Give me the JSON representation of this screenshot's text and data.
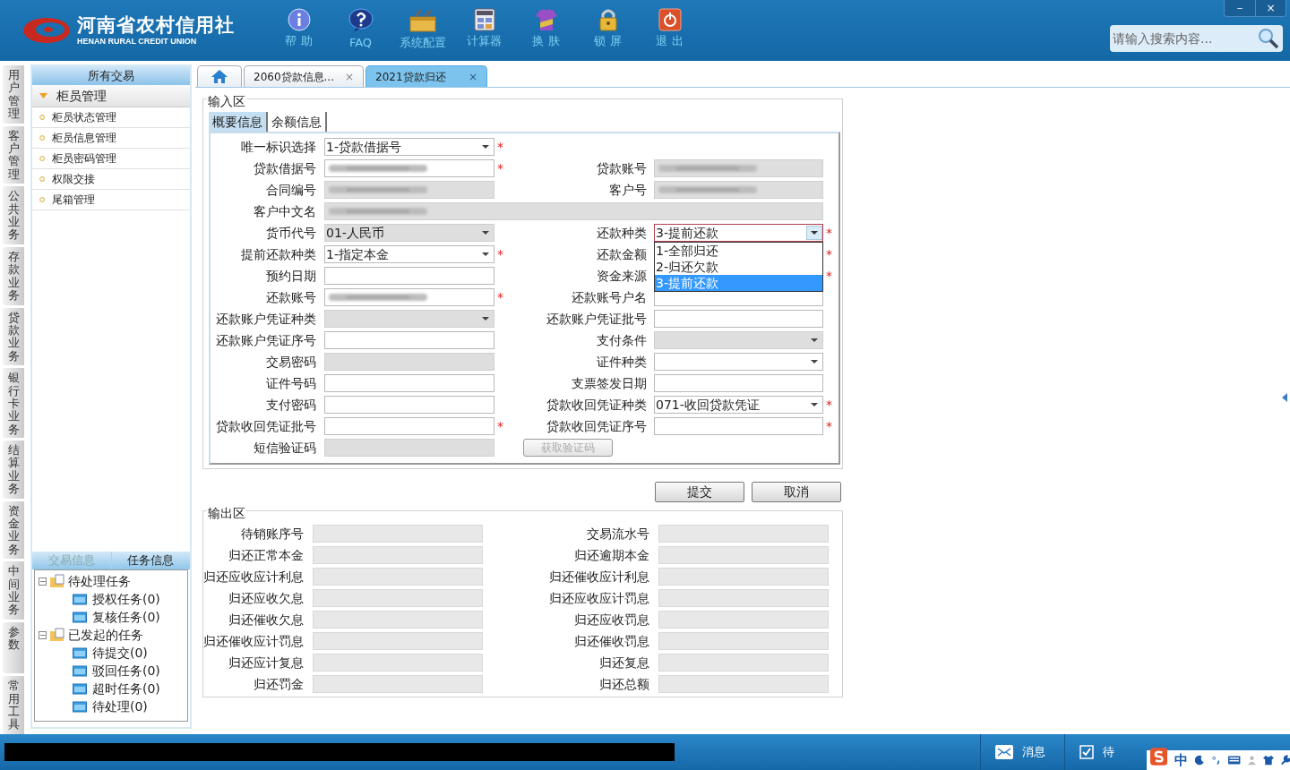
{
  "header": {
    "logo_cn": "河南省农村信用社",
    "logo_en": "HENAN RURAL CREDIT UNION",
    "tools": [
      {
        "label": "帮 助"
      },
      {
        "label": "FAQ"
      },
      {
        "label": "系统配置"
      },
      {
        "label": "计算器"
      },
      {
        "label": "换 肤"
      },
      {
        "label": "锁 屏"
      },
      {
        "label": "退 出"
      }
    ],
    "search": {
      "placeholder": "请输入搜索内容..."
    },
    "window_buttons": [
      "－",
      "×"
    ]
  },
  "side_tabs": [
    "用户管理",
    "客户管理",
    "公共业务",
    "存款业务",
    "贷款业务",
    "银行卡业务",
    "结算业务",
    "资金业务",
    "中间业务",
    "参数",
    "常用工具"
  ],
  "menu": {
    "title": "所有交易",
    "group": {
      "label": "柜员管理",
      "expanded": true,
      "items": [
        "柜员状态管理",
        "柜员信息管理",
        "柜员密码管理",
        "权限交接",
        "尾箱管理"
      ]
    }
  },
  "info_tabs": [
    {
      "label": "交易信息",
      "selected": false
    },
    {
      "label": "任务信息",
      "selected": true
    }
  ],
  "task_tree": [
    {
      "label": "待处理任务",
      "toggle": "−",
      "children": [
        {
          "label": "授权任务(0)"
        },
        {
          "label": "复核任务(0)"
        }
      ]
    },
    {
      "label": "已发起的任务",
      "toggle": "−",
      "children": [
        {
          "label": "待提交(0)"
        },
        {
          "label": "驳回任务(0)"
        },
        {
          "label": "超时任务(0)"
        },
        {
          "label": "待处理(0)"
        }
      ]
    }
  ],
  "doc_tabs": [
    {
      "kind": "home",
      "selected": false
    },
    {
      "kind": "text",
      "label": "2060贷款信息...",
      "close": "×",
      "selected": false
    },
    {
      "kind": "text",
      "label": "2021贷款归还",
      "close": "×",
      "selected": true
    }
  ],
  "input_area": {
    "title": "输入区",
    "tabs": [
      {
        "label": "概要信息",
        "selected": true
      },
      {
        "label": "余额信息",
        "selected": false
      }
    ],
    "rows": [
      {
        "left": {
          "label": "唯一标识选择",
          "kind": "select",
          "value": "1-贷款借据号",
          "mark": "*",
          "disabled": false
        }
      },
      {
        "left": {
          "label": "贷款借据号",
          "kind": "text",
          "redacted": true,
          "mark": "*",
          "disabled": false
        },
        "right": {
          "label": "贷款账号",
          "kind": "text",
          "redacted": true,
          "disabled": true
        }
      },
      {
        "left": {
          "label": "合同编号",
          "kind": "text",
          "redacted": true,
          "disabled": true
        },
        "right": {
          "label": "客户号",
          "kind": "text",
          "redacted": true,
          "disabled": true
        }
      },
      {
        "wide": true,
        "left": {
          "label": "客户中文名",
          "kind": "text",
          "redacted": true,
          "disabled": true
        }
      },
      {
        "left": {
          "label": "货币代号",
          "kind": "select",
          "value": "01-人民币",
          "disabled": true
        },
        "right": {
          "label": "还款种类",
          "kind": "select",
          "value": "3-提前还款",
          "mark": "*",
          "disabled": false,
          "open": true,
          "options": [
            {
              "label": "1-全部归还",
              "selected": false
            },
            {
              "label": "2-归还欠款",
              "selected": false
            },
            {
              "label": "3-提前还款",
              "selected": true
            }
          ]
        }
      },
      {
        "left": {
          "label": "提前还款种类",
          "kind": "select",
          "value": "1-指定本金",
          "mark": "*",
          "disabled": false
        },
        "right": {
          "label": "还款金额",
          "mark": "*"
        }
      },
      {
        "left": {
          "label": "预约日期",
          "kind": "text",
          "disabled": false
        },
        "right": {
          "label": "资金来源",
          "mark": "*"
        }
      },
      {
        "left": {
          "label": "还款账号",
          "kind": "text",
          "redacted": true,
          "mark": "*",
          "disabled": false
        },
        "right": {
          "label": "还款账号户名",
          "kind": "text",
          "disabled": false
        }
      },
      {
        "left": {
          "label": "还款账户凭证种类",
          "kind": "select",
          "disabled": true
        },
        "right": {
          "label": "还款账户凭证批号",
          "kind": "text",
          "disabled": false
        }
      },
      {
        "left": {
          "label": "还款账户凭证序号",
          "kind": "text",
          "disabled": false
        },
        "right": {
          "label": "支付条件",
          "kind": "select",
          "disabled": true
        }
      },
      {
        "left": {
          "label": "交易密码",
          "kind": "text",
          "disabled": true
        },
        "right": {
          "label": "证件种类",
          "kind": "select",
          "disabled": false
        }
      },
      {
        "left": {
          "label": "证件号码",
          "kind": "text",
          "disabled": false
        },
        "right": {
          "label": "支票签发日期",
          "kind": "text",
          "disabled": false
        }
      },
      {
        "left": {
          "label": "支付密码",
          "kind": "text",
          "disabled": false
        },
        "right": {
          "label": "贷款收回凭证种类",
          "kind": "select",
          "value": "071-收回贷款凭证",
          "mark": "*",
          "disabled": false
        }
      },
      {
        "left": {
          "label": "贷款收回凭证批号",
          "kind": "text",
          "mark": "*",
          "disabled": false
        },
        "right": {
          "label": "贷款收回凭证序号",
          "kind": "text",
          "mark": "*",
          "disabled": false
        }
      },
      {
        "left": {
          "label": "短信验证码",
          "kind": "text",
          "disabled": true
        },
        "button": {
          "label": "获取验证码",
          "disabled": true
        }
      }
    ]
  },
  "actions": [
    "提交",
    "取消"
  ],
  "output_area": {
    "title": "输出区",
    "rows": [
      [
        "待销账序号",
        "交易流水号"
      ],
      [
        "归还正常本金",
        "归还逾期本金"
      ],
      [
        "归还应收应计利息",
        "归还催收应计利息"
      ],
      [
        "归还应收欠息",
        "归还应收应计罚息"
      ],
      [
        "归还催收欠息",
        "归还应收罚息"
      ],
      [
        "归还催收应计罚息",
        "归还催收罚息"
      ],
      [
        "归还应计复息",
        "归还复息"
      ],
      [
        "归还罚金",
        "归还总额"
      ]
    ]
  },
  "status_bar": {
    "items": [
      {
        "label": "消息"
      },
      {
        "label": "待"
      }
    ],
    "ime": [
      "中"
    ]
  }
}
